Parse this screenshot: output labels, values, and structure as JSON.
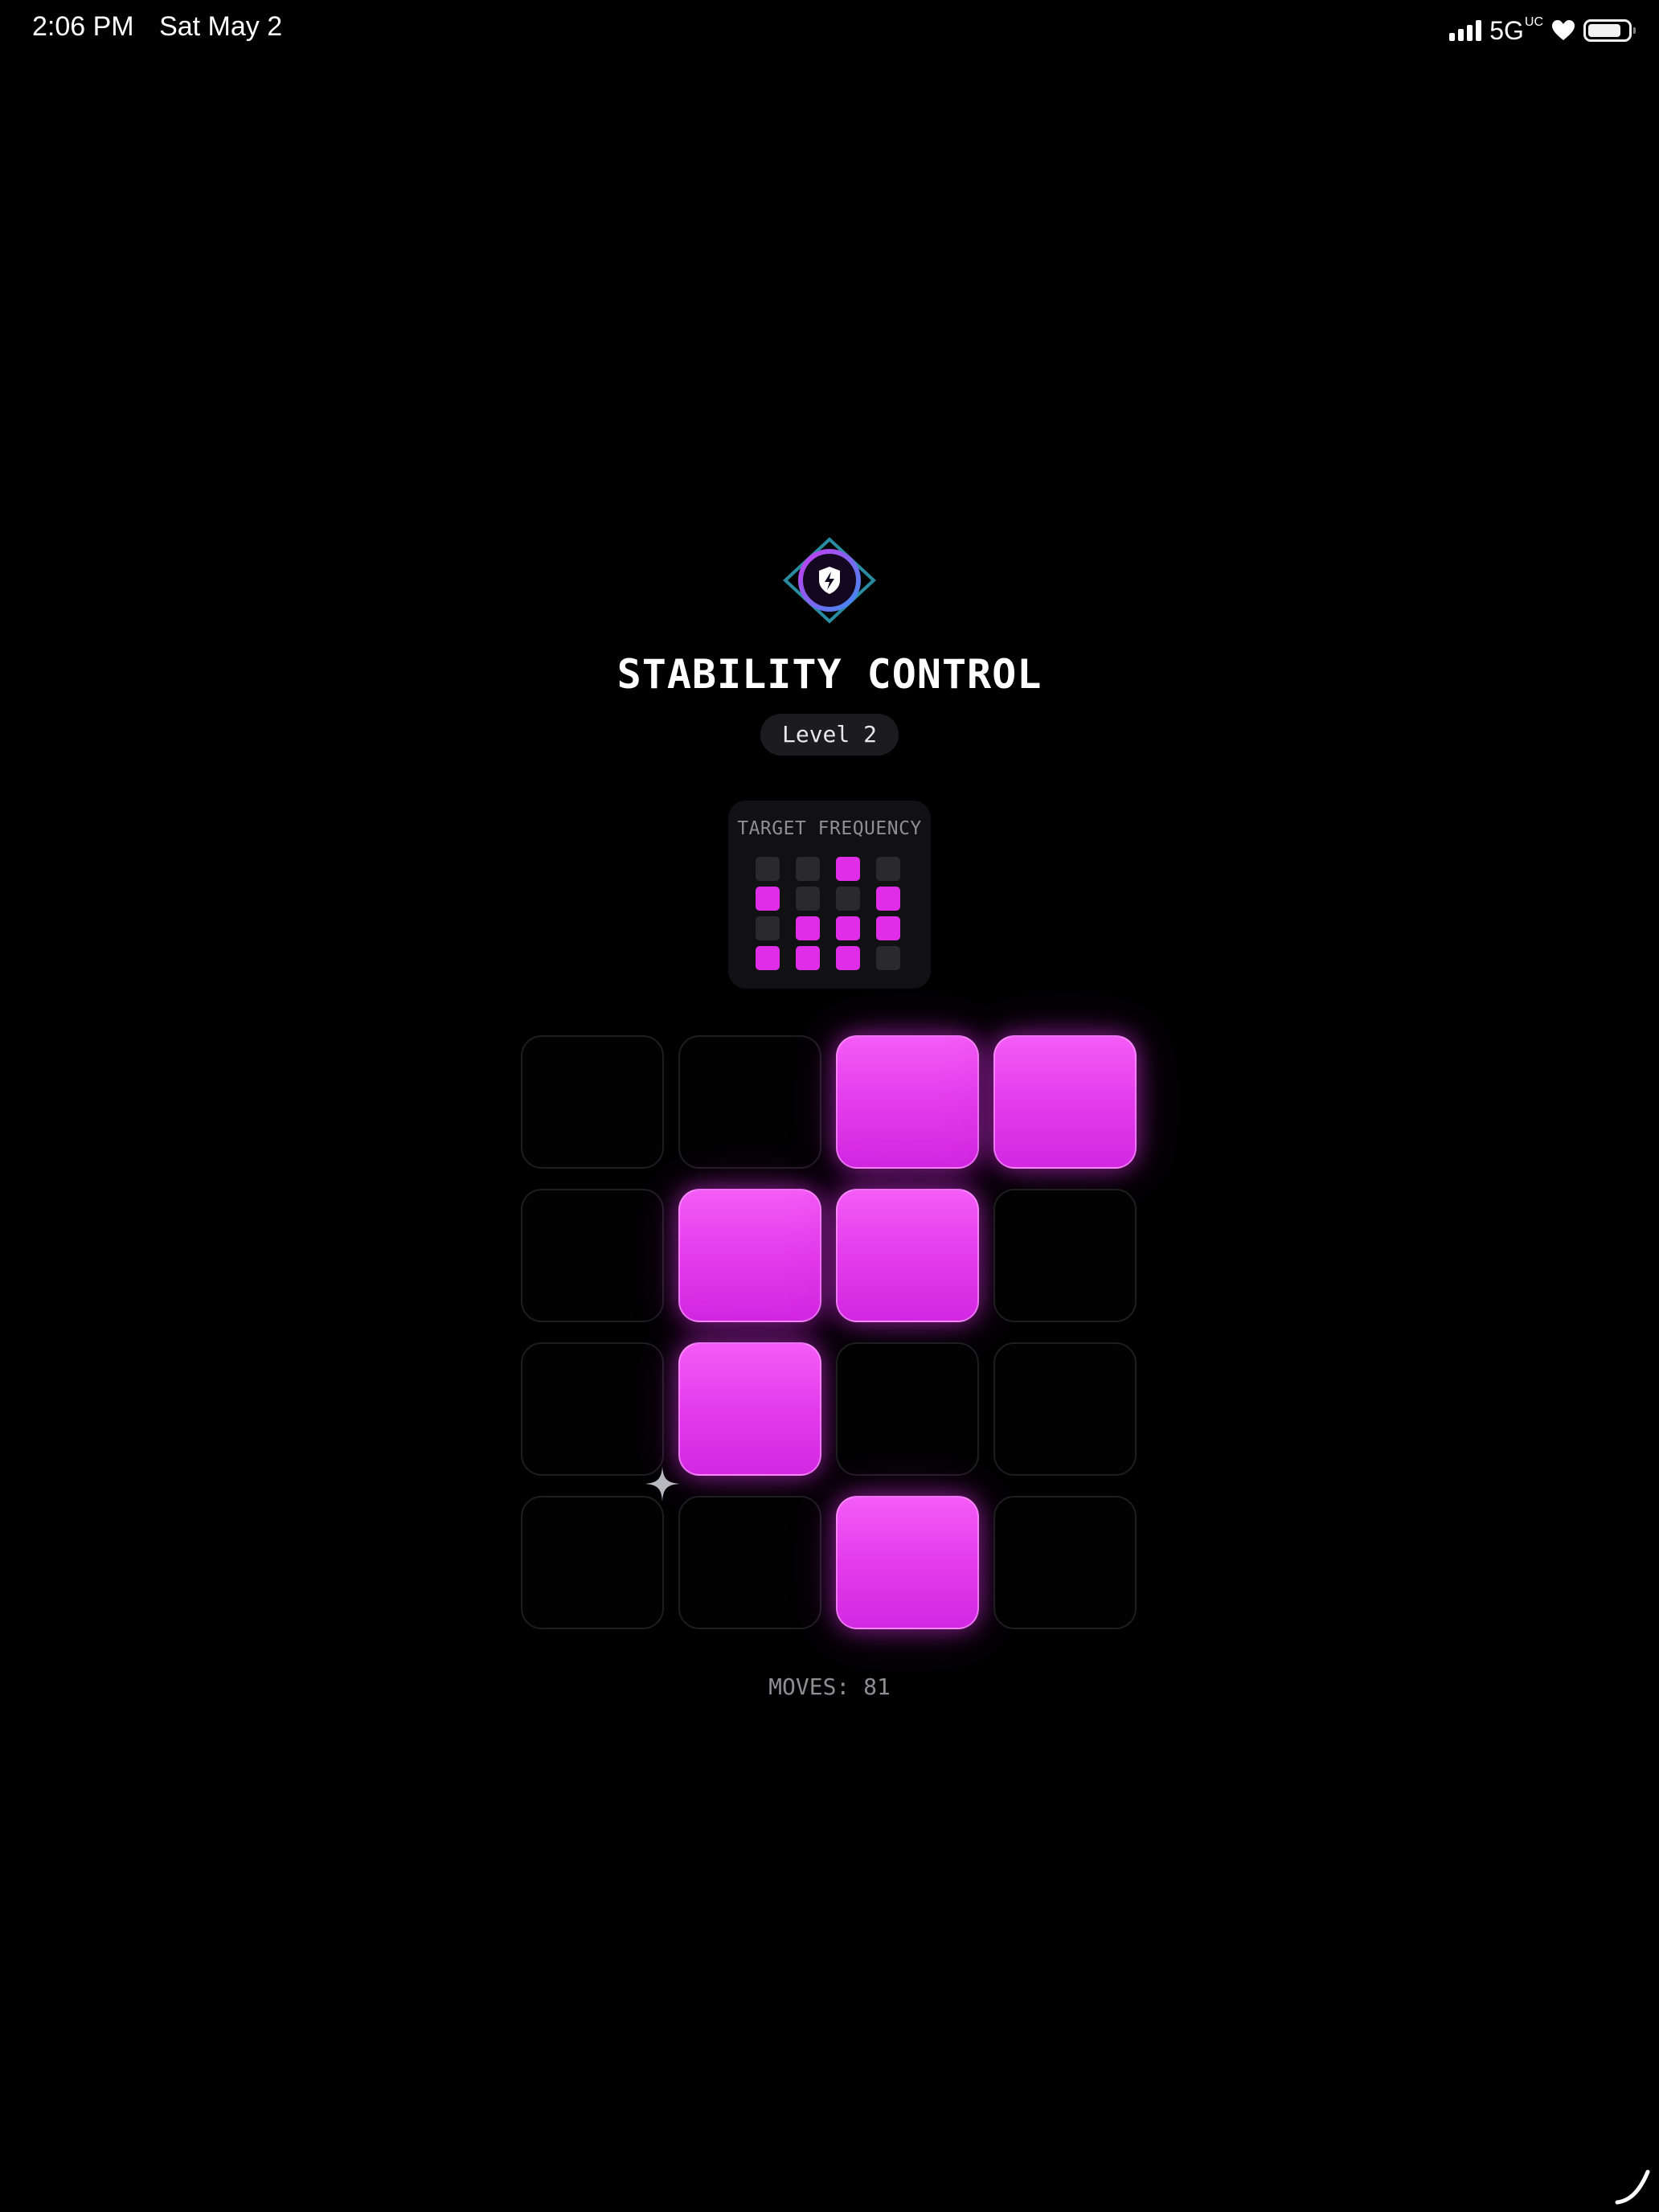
{
  "status_bar": {
    "time": "2:06 PM",
    "date": "Sat May 2",
    "network": "5G",
    "network_sup": "UC",
    "icons": [
      "signal-icon",
      "heart-icon",
      "battery-icon"
    ]
  },
  "game": {
    "logo_icon": "shield-bolt-icon",
    "title": "STABILITY CONTROL",
    "level_label": "Level 2",
    "target": {
      "label": "TARGET FREQUENCY",
      "pattern": [
        [
          0,
          0,
          1,
          0
        ],
        [
          1,
          0,
          0,
          1
        ],
        [
          0,
          1,
          1,
          1
        ],
        [
          1,
          1,
          1,
          0
        ]
      ]
    },
    "board": [
      [
        0,
        0,
        1,
        1
      ],
      [
        0,
        1,
        1,
        0
      ],
      [
        0,
        1,
        0,
        0
      ],
      [
        0,
        0,
        1,
        0
      ]
    ],
    "moves_text": "MOVES: 81"
  },
  "colors": {
    "background": "#000000",
    "accent": "#e43cec",
    "tile_off": "#020202",
    "target_off": "#2a2a2c"
  }
}
